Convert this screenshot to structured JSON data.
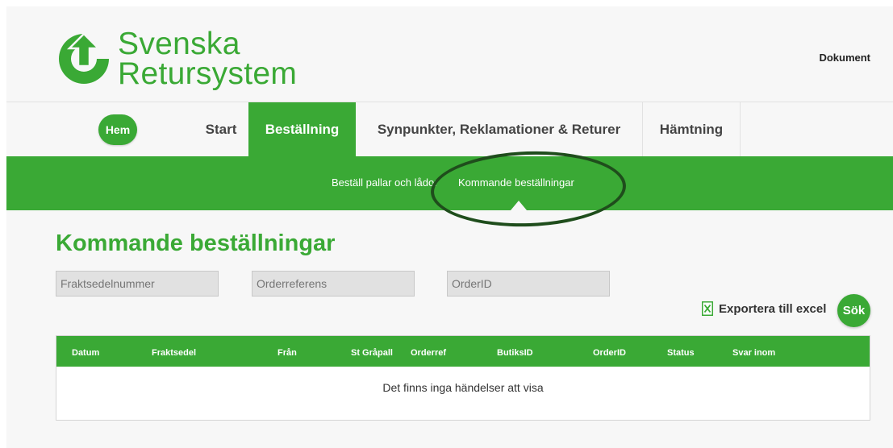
{
  "brand": {
    "line1": "Svenska",
    "line2": "Retursystem",
    "color": "#3aa935"
  },
  "header": {
    "documents_link": "Dokument"
  },
  "nav": {
    "home": "Hem",
    "items": [
      {
        "label": "Start"
      },
      {
        "label": "Beställning",
        "active": true
      },
      {
        "label": "Synpunkter, Reklamationer & Returer"
      },
      {
        "label": "Hämtning"
      }
    ]
  },
  "subnav": {
    "items": [
      {
        "label": "Beställ pallar och lådor"
      },
      {
        "label": "Kommande beställningar",
        "active": true
      }
    ]
  },
  "page": {
    "title": "Kommande beställningar"
  },
  "filters": [
    {
      "placeholder": "Fraktsedelnummer"
    },
    {
      "placeholder": "Orderreferens"
    },
    {
      "placeholder": "OrderID"
    }
  ],
  "actions": {
    "export_label": "Exportera till excel",
    "search_label": "Sök"
  },
  "table": {
    "columns": [
      "Datum",
      "Fraktsedel",
      "Från",
      "St Gråpall",
      "Orderref",
      "ButiksID",
      "OrderID",
      "Status",
      "Svar inom"
    ],
    "empty_message": "Det finns inga händelser att visa"
  },
  "icons": [
    "logo-icon",
    "excel-icon"
  ],
  "colors": {
    "accent": "#3aa935",
    "annotation_ellipse": "#1f4d1c"
  }
}
